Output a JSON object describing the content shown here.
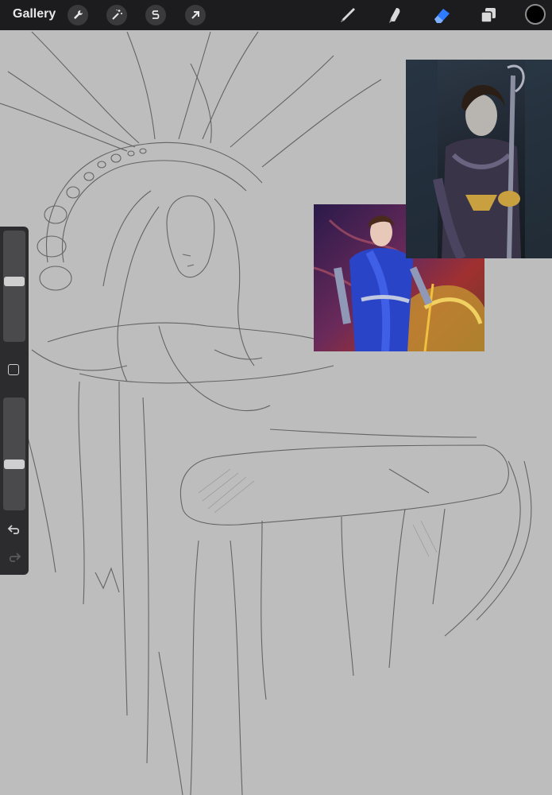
{
  "toolbar": {
    "gallery_label": "Gallery",
    "left_tools": [
      "wrench-icon",
      "magic-wand-icon",
      "selection-s-icon",
      "arrow-transform-icon"
    ],
    "right_tools": [
      "brush-icon",
      "smudge-icon",
      "eraser-icon",
      "layers-icon"
    ],
    "active_tool": "eraser-icon",
    "active_color": "#000000",
    "accent": "#2f7bff"
  },
  "sidebar": {
    "size_slider_level": 0.45,
    "opacity_slider_level": 0.6,
    "undo_icon": "undo-icon",
    "redo_icon": "redo-icon"
  },
  "canvas": {
    "background": "#bdbdbd"
  }
}
